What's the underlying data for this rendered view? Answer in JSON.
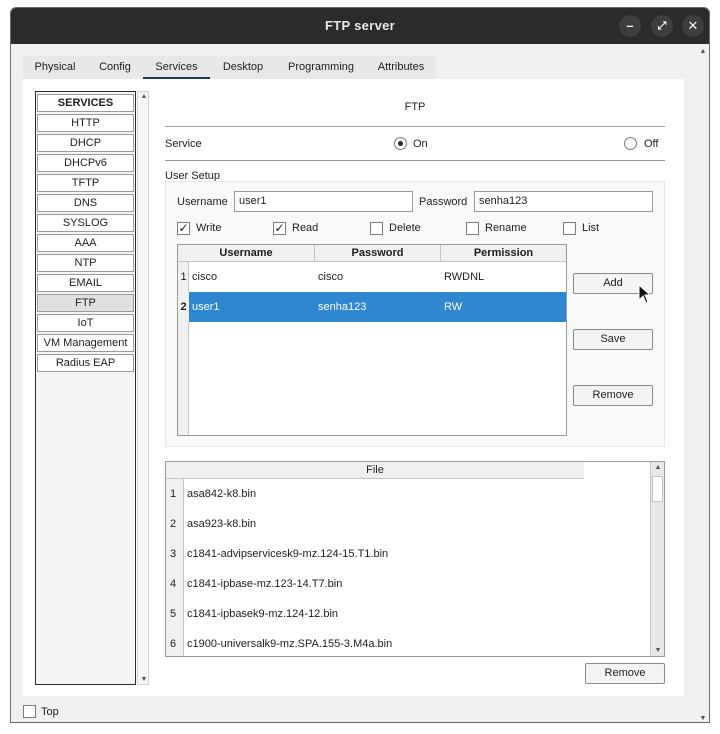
{
  "window": {
    "title": "FTP server"
  },
  "tabs": [
    "Physical",
    "Config",
    "Services",
    "Desktop",
    "Programming",
    "Attributes"
  ],
  "services": {
    "header": "SERVICES",
    "items": [
      "HTTP",
      "DHCP",
      "DHCPv6",
      "TFTP",
      "DNS",
      "SYSLOG",
      "AAA",
      "NTP",
      "EMAIL",
      "FTP",
      "IoT",
      "VM Management",
      "Radius EAP"
    ],
    "selected": "FTP"
  },
  "ftp": {
    "title": "FTP",
    "service_label": "Service",
    "on_label": "On",
    "off_label": "Off",
    "service_state": "On",
    "user_setup_label": "User Setup",
    "username_label": "Username",
    "username_value": "user1",
    "password_label": "Password",
    "password_value": "senha123",
    "permissions": {
      "write": {
        "label": "Write",
        "checked": true
      },
      "read": {
        "label": "Read",
        "checked": true
      },
      "delete": {
        "label": "Delete",
        "checked": false
      },
      "rename": {
        "label": "Rename",
        "checked": false
      },
      "list": {
        "label": "List",
        "checked": false
      }
    },
    "user_table": {
      "headers": [
        "Username",
        "Password",
        "Permission"
      ],
      "rows": [
        {
          "num": "1",
          "username": "cisco",
          "password": "cisco",
          "permission": "RWDNL"
        },
        {
          "num": "2",
          "username": "user1",
          "password": "senha123",
          "permission": "RW"
        }
      ],
      "selected_row": 2
    },
    "buttons": {
      "add": "Add",
      "save": "Save",
      "remove": "Remove"
    },
    "file_table": {
      "header": "File",
      "rows": [
        {
          "num": "1",
          "name": "asa842-k8.bin"
        },
        {
          "num": "2",
          "name": "asa923-k8.bin"
        },
        {
          "num": "3",
          "name": "c1841-advipservicesk9-mz.124-15.T1.bin"
        },
        {
          "num": "4",
          "name": "c1841-ipbase-mz.123-14.T7.bin"
        },
        {
          "num": "5",
          "name": "c1841-ipbasek9-mz.124-12.bin"
        },
        {
          "num": "6",
          "name": "c1900-universalk9-mz.SPA.155-3.M4a.bin"
        }
      ]
    },
    "file_remove": "Remove"
  },
  "footer": {
    "top_label": "Top",
    "top_checked": false
  },
  "colors": {
    "titlebar": "#2b2b2b",
    "selection": "#2f87cf",
    "tab_indicator": "#1c3a5e"
  }
}
